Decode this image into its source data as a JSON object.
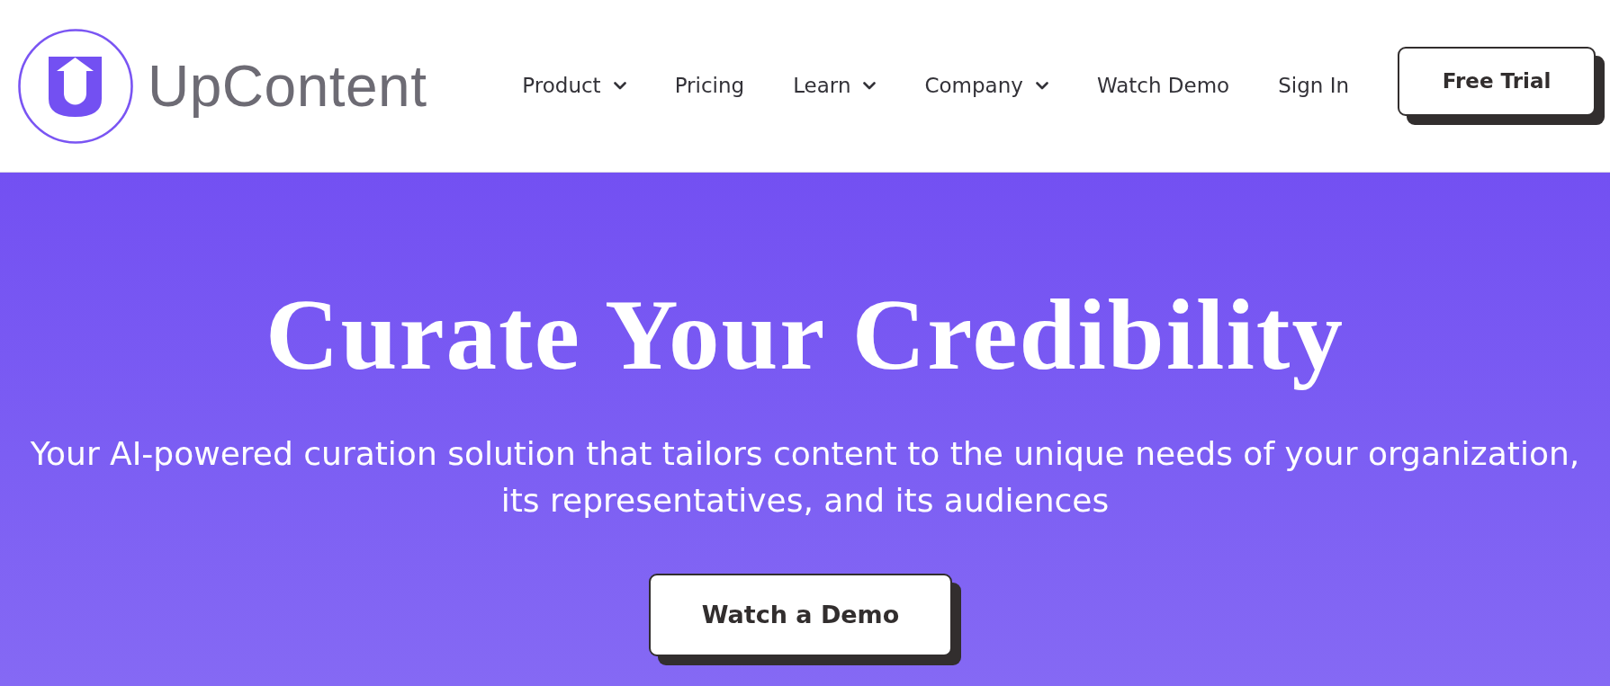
{
  "header": {
    "logo": {
      "text": "UpContent"
    },
    "nav": [
      {
        "label": "Product",
        "dropdown": true
      },
      {
        "label": "Pricing",
        "dropdown": false
      },
      {
        "label": "Learn",
        "dropdown": true
      },
      {
        "label": "Company",
        "dropdown": true
      },
      {
        "label": "Watch Demo",
        "dropdown": false
      },
      {
        "label": "Sign In",
        "dropdown": false
      }
    ],
    "cta": "Free Trial"
  },
  "hero": {
    "title": "Curate Your Credibility",
    "subtitle": "Your AI-powered curation solution that tailors content to the unique needs of your organization, its representatives, and its audiences",
    "button": "Watch a Demo"
  }
}
